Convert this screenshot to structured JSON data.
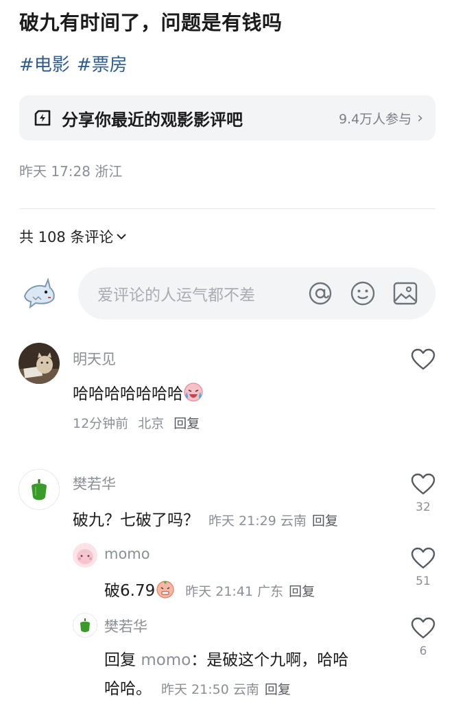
{
  "post": {
    "title": "破九有时间了，问题是有钱吗",
    "tags": [
      "#电影",
      "#票房"
    ],
    "topic": {
      "label": "分享你最近的观影影评吧",
      "participants": "9.4万人参与"
    },
    "time": "昨天 17:28 浙江"
  },
  "comments_header": {
    "count_label": "共 108 条评论"
  },
  "composer": {
    "placeholder": "爱评论的人运气都不差"
  },
  "comments": [
    {
      "name": "明天见",
      "text": "哈哈哈哈哈哈哈",
      "time": "12分钟前",
      "location": "北京",
      "reply_label": "回复"
    },
    {
      "name": "樊若华",
      "text": "破九？七破了吗？",
      "time": "昨天 21:29",
      "location": "云南",
      "reply_label": "回复",
      "likes": "32"
    }
  ],
  "replies": [
    {
      "name": "momo",
      "text": "破6.79",
      "time": "昨天 21:41",
      "location": "广东",
      "reply_label": "回复",
      "likes": "51"
    },
    {
      "name": "樊若华",
      "reply_prefix": "回复",
      "reply_to": "momo",
      "text_line1": "：是破这个九啊，哈哈",
      "text_line2": "哈哈。",
      "time": "昨天 21:50",
      "location": "云南",
      "reply_label": "回复",
      "likes": "6"
    }
  ],
  "colors": {
    "tag": "#2f5c8a",
    "muted": "#8a8f96",
    "card_bg": "#f3f4f6",
    "pepper": "#3a9b2a"
  }
}
